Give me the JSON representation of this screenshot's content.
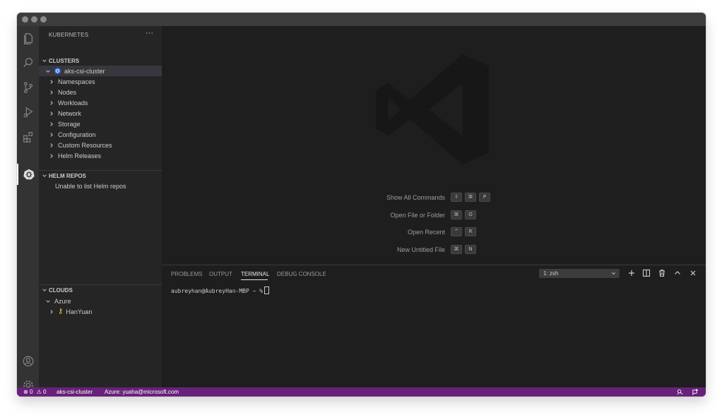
{
  "sidebar": {
    "title": "KUBERNETES",
    "more_icon": "ellipsis-icon",
    "clusters": {
      "header": "CLUSTERS",
      "cluster_name": "aks-csi-cluster",
      "children": [
        "Namespaces",
        "Nodes",
        "Workloads",
        "Network",
        "Storage",
        "Configuration",
        "Custom Resources",
        "Helm Releases"
      ]
    },
    "helm": {
      "header": "HELM REPOS",
      "message": "Unable to list Helm repos"
    },
    "clouds": {
      "header": "CLOUDS",
      "provider": "Azure",
      "subscription": "HanYuan"
    }
  },
  "editor": {
    "shortcuts": [
      {
        "label": "Show All Commands",
        "keys": [
          "⇧",
          "⌘",
          "P"
        ]
      },
      {
        "label": "Open File or Folder",
        "keys": [
          "⌘",
          "O"
        ]
      },
      {
        "label": "Open Recent",
        "keys": [
          "^",
          "R"
        ]
      },
      {
        "label": "New Untitled File",
        "keys": [
          "⌘",
          "N"
        ]
      }
    ]
  },
  "panel": {
    "tabs": [
      "PROBLEMS",
      "OUTPUT",
      "TERMINAL",
      "DEBUG CONSOLE"
    ],
    "active_tab": "TERMINAL",
    "terminal_select": "1: zsh",
    "prompt": "aubreyhan@AubreyHan-MBP ~ %"
  },
  "statusbar": {
    "errors": "0",
    "warnings": "0",
    "cluster": "aks-csi-cluster",
    "account": "Azure: yuaha@microsoft.com"
  },
  "colors": {
    "statusbar": "#68217a",
    "activitybar": "#333333",
    "sidebar": "#252526",
    "editor": "#1e1e1e"
  }
}
